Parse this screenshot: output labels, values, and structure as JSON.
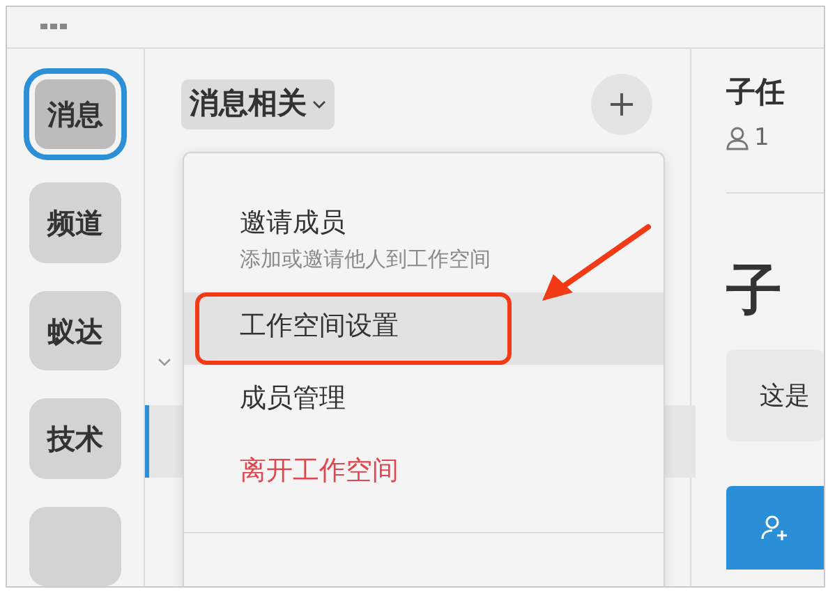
{
  "workspaces": [
    {
      "label": "消息",
      "selected": true
    },
    {
      "label": "频道",
      "selected": false
    },
    {
      "label": "蚁达",
      "selected": false
    },
    {
      "label": "技术",
      "selected": false
    }
  ],
  "channel_header": {
    "title": "消息相关"
  },
  "menu": {
    "items": [
      {
        "kind": "option",
        "label": "邀请成员",
        "description": "添加或邀请他人到工作空间",
        "selected": false,
        "annotated": false
      },
      {
        "kind": "option",
        "label": "工作空间设置",
        "selected": true,
        "annotated": true
      },
      {
        "kind": "option",
        "label": "成员管理",
        "selected": false,
        "annotated": false
      },
      {
        "kind": "danger",
        "label": "离开工作空间",
        "selected": false,
        "annotated": false
      }
    ]
  },
  "task": {
    "title": "子任",
    "member_count": "1",
    "heading": "子",
    "description": "这是"
  }
}
